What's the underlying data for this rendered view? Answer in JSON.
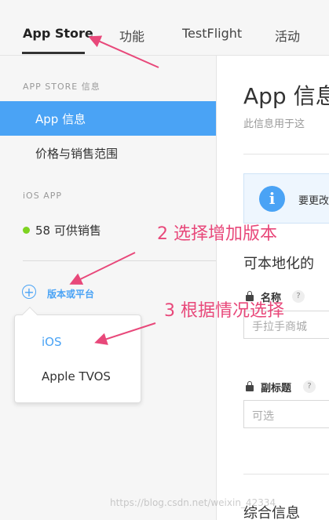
{
  "tabs": [
    "App Store",
    "功能",
    "TestFlight",
    "活动"
  ],
  "sidebar": {
    "section1_header": "APP STORE 信息",
    "items": [
      "App 信息",
      "价格与销售范围"
    ],
    "section2_header": "iOS APP",
    "version_status": "58 可供销售",
    "add_version_label": "版本或平台"
  },
  "popover": {
    "options": [
      "iOS",
      "Apple TVOS"
    ]
  },
  "main": {
    "title": "App 信息",
    "subtitle": "此信息用于这",
    "info_text": "要更改",
    "localizable_heading": "可本地化的",
    "name_label": "名称",
    "name_value": "手拉手商城",
    "subtitle_label": "副标题",
    "subtitle_placeholder": "可选",
    "general_info_heading": "综合信息"
  },
  "annotations": {
    "step2": "2 选择增加版本",
    "step3": "3 根据情况选择"
  },
  "watermark": "https://blog.csdn.net/weixin_42334",
  "colors": {
    "accent": "#4aa3f5",
    "status_green": "#7ed321",
    "annotation": "#e8487a"
  }
}
